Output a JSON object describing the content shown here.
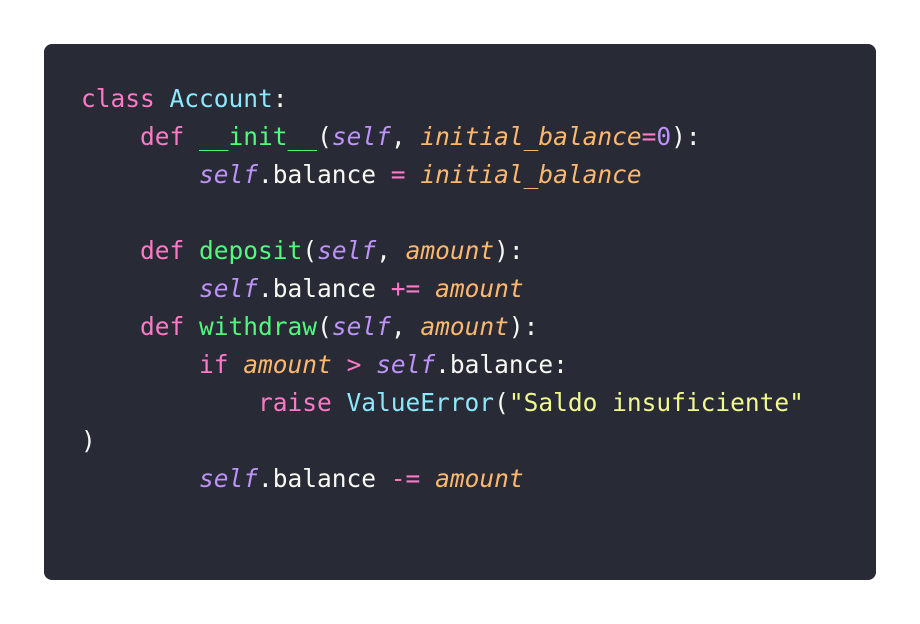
{
  "code": {
    "language": "python",
    "lines": [
      [
        {
          "t": "class",
          "k": "kw"
        },
        {
          "t": " ",
          "k": "plain"
        },
        {
          "t": "Account",
          "k": "cls"
        },
        {
          "t": ":",
          "k": "plain"
        }
      ],
      [
        {
          "t": "    ",
          "k": "plain"
        },
        {
          "t": "def",
          "k": "kw"
        },
        {
          "t": " ",
          "k": "plain"
        },
        {
          "t": "__init__",
          "k": "fn"
        },
        {
          "t": "(",
          "k": "plain"
        },
        {
          "t": "self",
          "k": "selfv"
        },
        {
          "t": ", ",
          "k": "plain"
        },
        {
          "t": "initial_balance",
          "k": "param"
        },
        {
          "t": "=",
          "k": "op"
        },
        {
          "t": "0",
          "k": "num"
        },
        {
          "t": "):",
          "k": "plain"
        }
      ],
      [
        {
          "t": "        ",
          "k": "plain"
        },
        {
          "t": "self",
          "k": "selfv"
        },
        {
          "t": ".balance ",
          "k": "plain"
        },
        {
          "t": "=",
          "k": "op"
        },
        {
          "t": " ",
          "k": "plain"
        },
        {
          "t": "initial_balance",
          "k": "param"
        }
      ],
      [],
      [
        {
          "t": "    ",
          "k": "plain"
        },
        {
          "t": "def",
          "k": "kw"
        },
        {
          "t": " ",
          "k": "plain"
        },
        {
          "t": "deposit",
          "k": "fn"
        },
        {
          "t": "(",
          "k": "plain"
        },
        {
          "t": "self",
          "k": "selfv"
        },
        {
          "t": ", ",
          "k": "plain"
        },
        {
          "t": "amount",
          "k": "param"
        },
        {
          "t": "):",
          "k": "plain"
        }
      ],
      [
        {
          "t": "        ",
          "k": "plain"
        },
        {
          "t": "self",
          "k": "selfv"
        },
        {
          "t": ".balance ",
          "k": "plain"
        },
        {
          "t": "+=",
          "k": "op"
        },
        {
          "t": " ",
          "k": "plain"
        },
        {
          "t": "amount",
          "k": "param"
        }
      ],
      [
        {
          "t": "    ",
          "k": "plain"
        },
        {
          "t": "def",
          "k": "kw"
        },
        {
          "t": " ",
          "k": "plain"
        },
        {
          "t": "withdraw",
          "k": "fn"
        },
        {
          "t": "(",
          "k": "plain"
        },
        {
          "t": "self",
          "k": "selfv"
        },
        {
          "t": ", ",
          "k": "plain"
        },
        {
          "t": "amount",
          "k": "param"
        },
        {
          "t": "):",
          "k": "plain"
        }
      ],
      [
        {
          "t": "        ",
          "k": "plain"
        },
        {
          "t": "if",
          "k": "kw"
        },
        {
          "t": " ",
          "k": "plain"
        },
        {
          "t": "amount",
          "k": "param"
        },
        {
          "t": " ",
          "k": "plain"
        },
        {
          "t": ">",
          "k": "op"
        },
        {
          "t": " ",
          "k": "plain"
        },
        {
          "t": "self",
          "k": "selfv"
        },
        {
          "t": ".balance:",
          "k": "plain"
        }
      ],
      [
        {
          "t": "            ",
          "k": "plain"
        },
        {
          "t": "raise",
          "k": "kw"
        },
        {
          "t": " ",
          "k": "plain"
        },
        {
          "t": "ValueError",
          "k": "builtin"
        },
        {
          "t": "(",
          "k": "plain"
        },
        {
          "t": "\"Saldo insuficiente\"",
          "k": "str"
        }
      ],
      [
        {
          "t": ")",
          "k": "plain"
        }
      ],
      [
        {
          "t": "        ",
          "k": "plain"
        },
        {
          "t": "self",
          "k": "selfv"
        },
        {
          "t": ".balance ",
          "k": "plain"
        },
        {
          "t": "-=",
          "k": "op"
        },
        {
          "t": " ",
          "k": "plain"
        },
        {
          "t": "amount",
          "k": "param"
        }
      ]
    ]
  },
  "colors": {
    "panel_background": "#282a36",
    "keyword": "#ff79c6",
    "class_name": "#8be9fd",
    "function_name": "#50fa7b",
    "self": "#bd93f9",
    "parameter": "#ffb86c",
    "string": "#f1fa8c",
    "text": "#f8f8f2"
  }
}
